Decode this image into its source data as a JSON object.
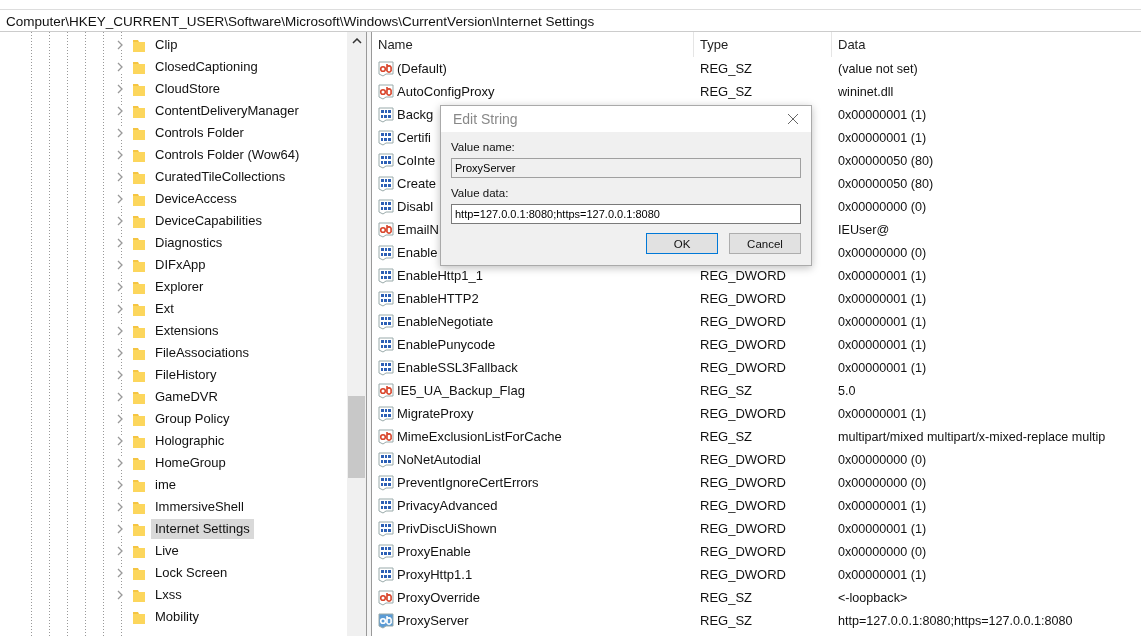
{
  "address_bar": {
    "path": "Computer\\HKEY_CURRENT_USER\\Software\\Microsoft\\Windows\\CurrentVersion\\Internet Settings"
  },
  "tree": {
    "items": [
      {
        "label": "Clip",
        "expandable": true,
        "selected": false
      },
      {
        "label": "ClosedCaptioning",
        "expandable": true,
        "selected": false
      },
      {
        "label": "CloudStore",
        "expandable": true,
        "selected": false
      },
      {
        "label": "ContentDeliveryManager",
        "expandable": true,
        "selected": false
      },
      {
        "label": "Controls Folder",
        "expandable": true,
        "selected": false
      },
      {
        "label": "Controls Folder (Wow64)",
        "expandable": true,
        "selected": false
      },
      {
        "label": "CuratedTileCollections",
        "expandable": true,
        "selected": false
      },
      {
        "label": "DeviceAccess",
        "expandable": true,
        "selected": false
      },
      {
        "label": "DeviceCapabilities",
        "expandable": true,
        "selected": false
      },
      {
        "label": "Diagnostics",
        "expandable": true,
        "selected": false
      },
      {
        "label": "DIFxApp",
        "expandable": true,
        "selected": false
      },
      {
        "label": "Explorer",
        "expandable": true,
        "selected": false
      },
      {
        "label": "Ext",
        "expandable": true,
        "selected": false
      },
      {
        "label": "Extensions",
        "expandable": true,
        "selected": false
      },
      {
        "label": "FileAssociations",
        "expandable": true,
        "selected": false
      },
      {
        "label": "FileHistory",
        "expandable": true,
        "selected": false
      },
      {
        "label": "GameDVR",
        "expandable": true,
        "selected": false
      },
      {
        "label": "Group Policy",
        "expandable": true,
        "selected": false
      },
      {
        "label": "Holographic",
        "expandable": true,
        "selected": false
      },
      {
        "label": "HomeGroup",
        "expandable": true,
        "selected": false
      },
      {
        "label": "ime",
        "expandable": true,
        "selected": false
      },
      {
        "label": "ImmersiveShell",
        "expandable": true,
        "selected": false
      },
      {
        "label": "Internet Settings",
        "expandable": true,
        "selected": true
      },
      {
        "label": "Live",
        "expandable": true,
        "selected": false
      },
      {
        "label": "Lock Screen",
        "expandable": true,
        "selected": false
      },
      {
        "label": "Lxss",
        "expandable": true,
        "selected": false
      },
      {
        "label": "Mobility",
        "expandable": false,
        "selected": false
      }
    ]
  },
  "list": {
    "columns": [
      "Name",
      "Type",
      "Data"
    ],
    "rows": [
      {
        "kind": "string",
        "name": "(Default)",
        "type": "REG_SZ",
        "data": "(value not set)",
        "selected": false
      },
      {
        "kind": "string",
        "name": "AutoConfigProxy",
        "type": "REG_SZ",
        "data": "wininet.dll",
        "selected": false
      },
      {
        "kind": "binary",
        "name": "Backg",
        "data": "0x00000001 (1)",
        "selected": false
      },
      {
        "kind": "binary",
        "name": "Certifi",
        "data": "0x00000001 (1)",
        "selected": false
      },
      {
        "kind": "binary",
        "name": "CoInte",
        "data": "0x00000050 (80)",
        "selected": false
      },
      {
        "kind": "binary",
        "name": "Create",
        "data": "0x00000050 (80)",
        "selected": false
      },
      {
        "kind": "binary",
        "name": "Disabl",
        "data": "0x00000000 (0)",
        "selected": false
      },
      {
        "kind": "string",
        "name": "EmailN",
        "data": "IEUser@",
        "selected": false
      },
      {
        "kind": "binary",
        "name": "Enable",
        "data": "0x00000000 (0)",
        "selected": false
      },
      {
        "kind": "binary",
        "name": "EnableHttp1_1",
        "type": "REG_DWORD",
        "data": "0x00000001 (1)",
        "selected": false
      },
      {
        "kind": "binary",
        "name": "EnableHTTP2",
        "type": "REG_DWORD",
        "data": "0x00000001 (1)",
        "selected": false
      },
      {
        "kind": "binary",
        "name": "EnableNegotiate",
        "type": "REG_DWORD",
        "data": "0x00000001 (1)",
        "selected": false
      },
      {
        "kind": "binary",
        "name": "EnablePunycode",
        "type": "REG_DWORD",
        "data": "0x00000001 (1)",
        "selected": false
      },
      {
        "kind": "binary",
        "name": "EnableSSL3Fallback",
        "type": "REG_DWORD",
        "data": "0x00000001 (1)",
        "selected": false
      },
      {
        "kind": "string",
        "name": "IE5_UA_Backup_Flag",
        "type": "REG_SZ",
        "data": "5.0",
        "selected": false
      },
      {
        "kind": "binary",
        "name": "MigrateProxy",
        "type": "REG_DWORD",
        "data": "0x00000001 (1)",
        "selected": false
      },
      {
        "kind": "string",
        "name": "MimeExclusionListForCache",
        "type": "REG_SZ",
        "data": "multipart/mixed multipart/x-mixed-replace multip",
        "selected": false
      },
      {
        "kind": "binary",
        "name": "NoNetAutodial",
        "type": "REG_DWORD",
        "data": "0x00000000 (0)",
        "selected": false
      },
      {
        "kind": "binary",
        "name": "PreventIgnoreCertErrors",
        "type": "REG_DWORD",
        "data": "0x00000000 (0)",
        "selected": false
      },
      {
        "kind": "binary",
        "name": "PrivacyAdvanced",
        "type": "REG_DWORD",
        "data": "0x00000001 (1)",
        "selected": false
      },
      {
        "kind": "binary",
        "name": "PrivDiscUiShown",
        "type": "REG_DWORD",
        "data": "0x00000001 (1)",
        "selected": false
      },
      {
        "kind": "binary",
        "name": "ProxyEnable",
        "type": "REG_DWORD",
        "data": "0x00000000 (0)",
        "selected": false
      },
      {
        "kind": "binary",
        "name": "ProxyHttp1.1",
        "type": "REG_DWORD",
        "data": "0x00000001 (1)",
        "selected": false
      },
      {
        "kind": "string",
        "name": "ProxyOverride",
        "type": "REG_SZ",
        "data": "<-loopback>",
        "selected": false
      },
      {
        "kind": "string",
        "name": "ProxyServer",
        "type": "REG_SZ",
        "data": "http=127.0.0.1:8080;https=127.0.0.1:8080",
        "selected": true
      }
    ]
  },
  "dialog": {
    "title": "Edit String",
    "fields": [
      {
        "label": "Value name:",
        "value": "ProxyServer",
        "readonly": true
      },
      {
        "label": "Value data:",
        "value": "http=127.0.0.1:8080;https=127.0.0.1:8080",
        "readonly": false
      }
    ],
    "buttons": [
      {
        "label": "OK",
        "default": true
      },
      {
        "label": "Cancel",
        "default": false
      }
    ]
  }
}
